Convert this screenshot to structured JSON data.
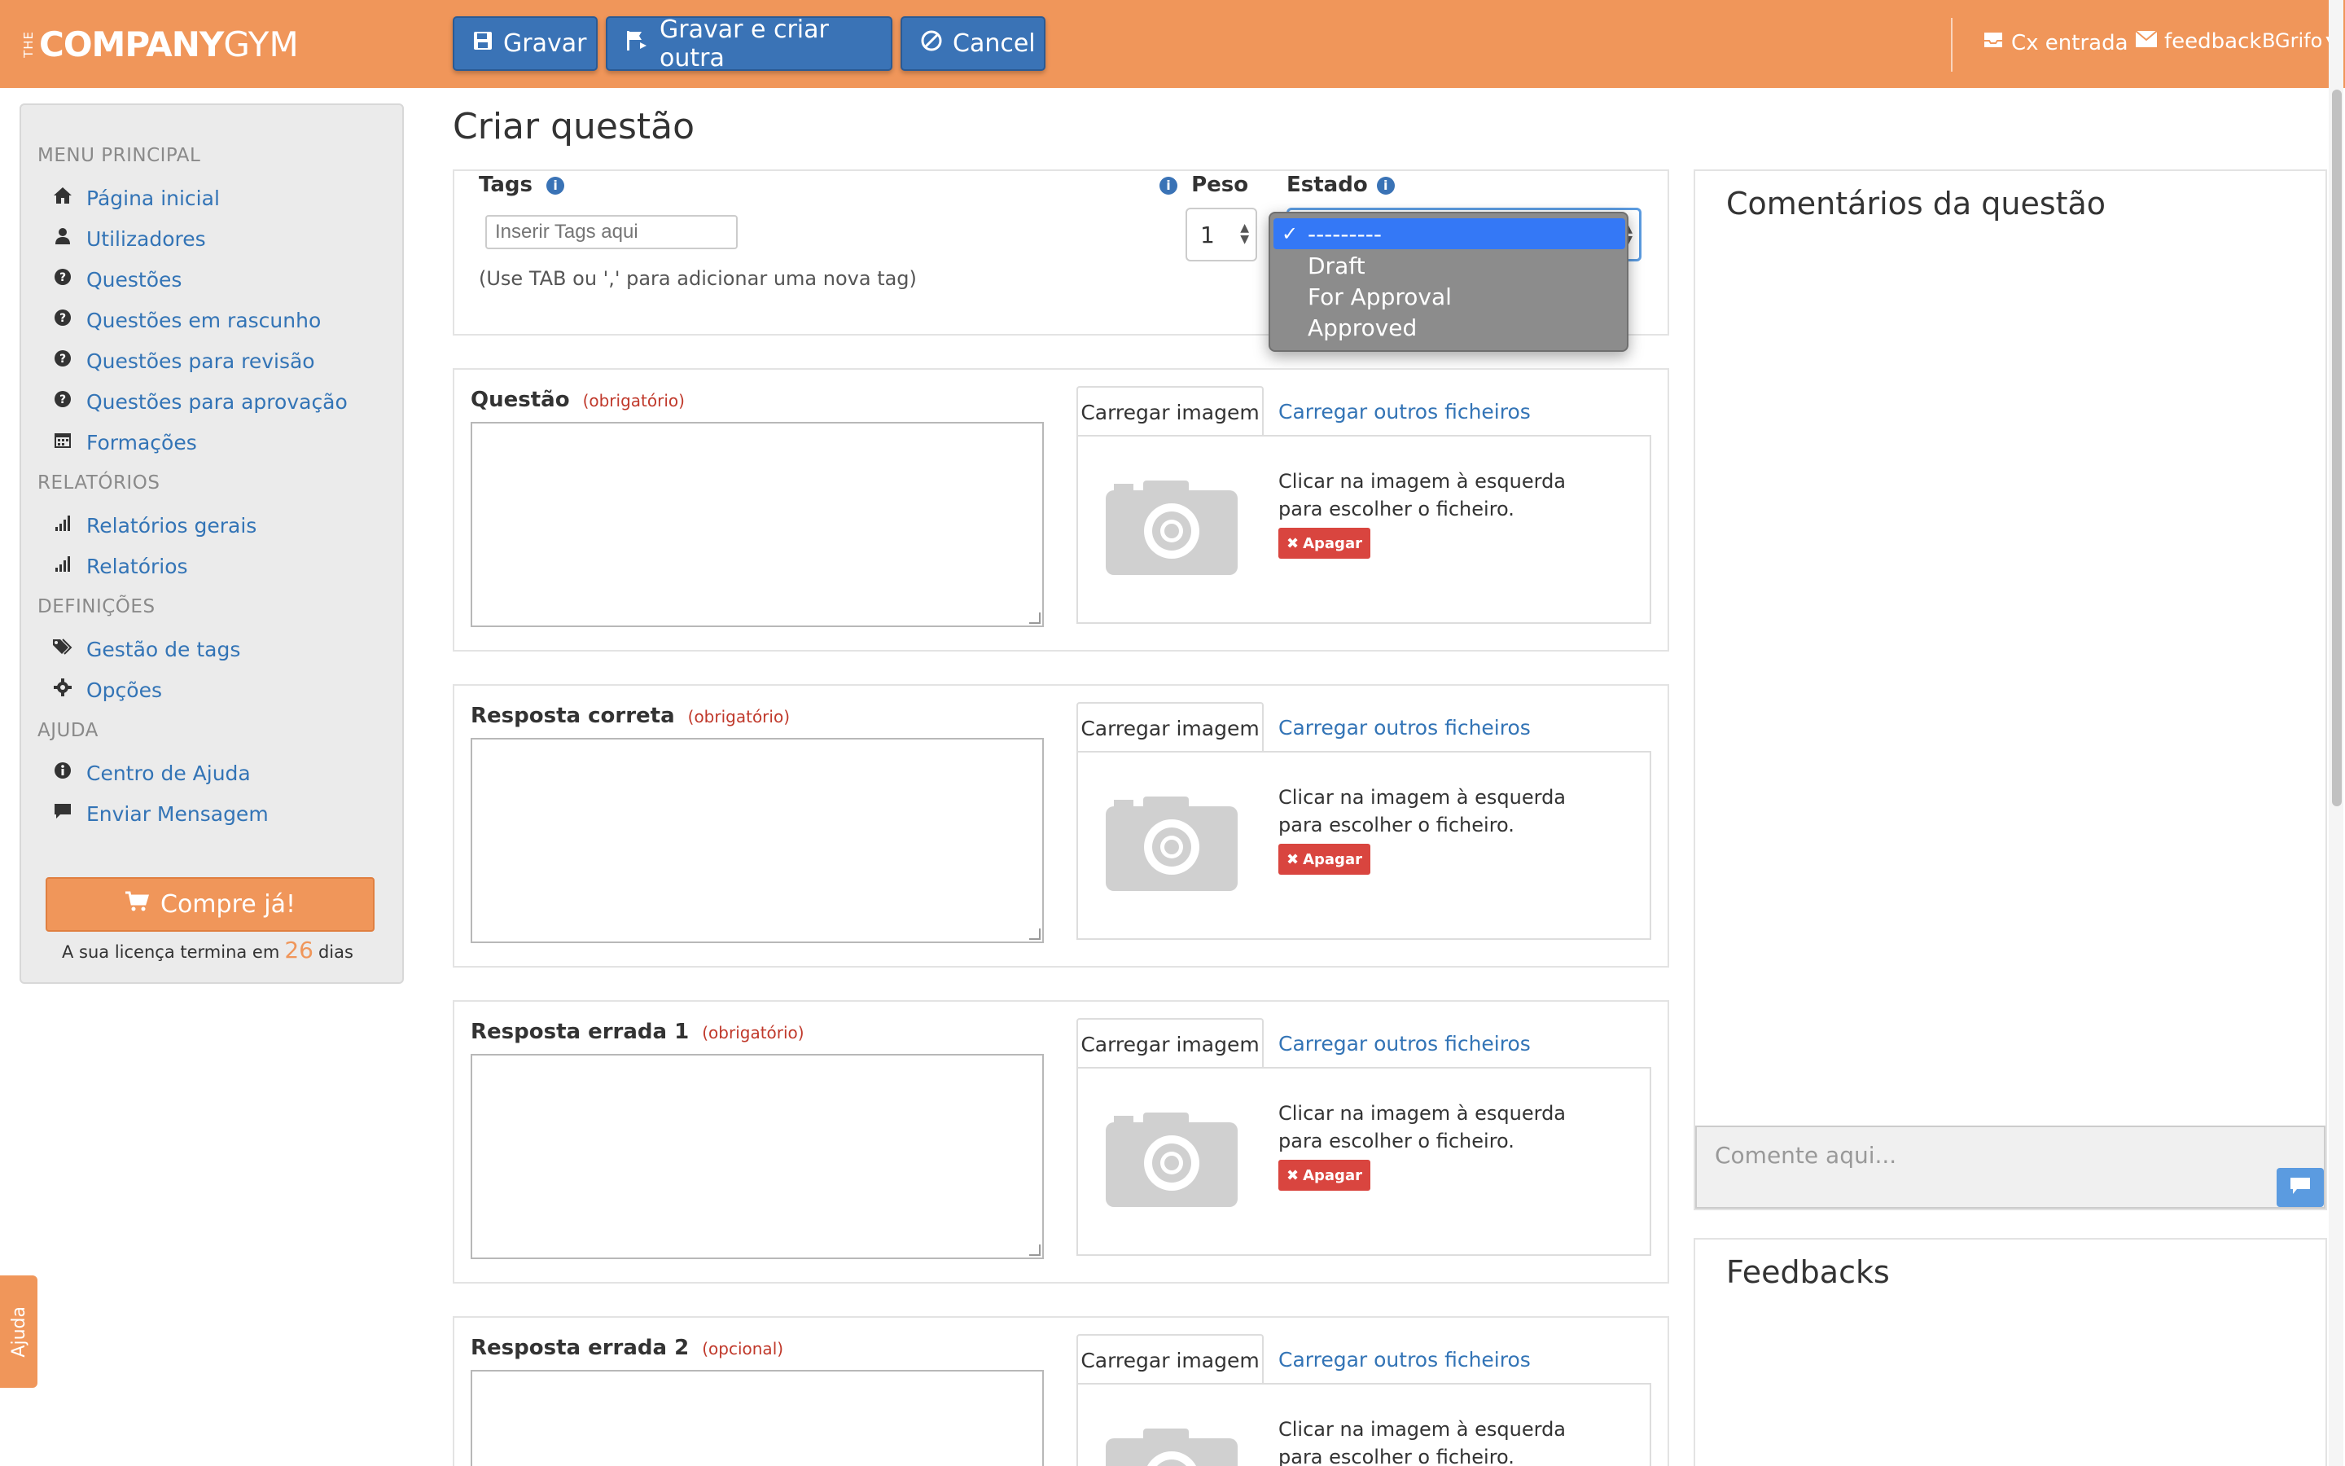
{
  "brand": {
    "the": "THE",
    "company": "COMPANY",
    "gym": "GYM"
  },
  "toolbar": {
    "save": "Gravar",
    "save_new": "Gravar e criar outra",
    "cancel": "Cancel"
  },
  "topright": {
    "inbox": "Cx entrada",
    "feedback": "feedback",
    "user": "BGrifo"
  },
  "sidebar": {
    "menu_principal": "MENU PRINCIPAL",
    "items_main": [
      "Página inicial",
      "Utilizadores",
      "Questões",
      "Questões em rascunho",
      "Questões para revisão",
      "Questões para aprovação",
      "Formações"
    ],
    "relatorios": "RELATÓRIOS",
    "items_rel": [
      "Relatórios gerais",
      "Relatórios"
    ],
    "definicoes": "DEFINIÇÕES",
    "items_def": [
      "Gestão de tags",
      "Opções"
    ],
    "ajuda": "AJUDA",
    "items_help": [
      "Centro de Ajuda",
      "Enviar Mensagem"
    ],
    "buy": "Compre já!",
    "license_prefix": "A sua licença termina em",
    "license_days": "26",
    "license_suffix": "dias"
  },
  "page": {
    "title": "Criar questão"
  },
  "meta": {
    "tags_label": "Tags",
    "tags_placeholder": "Inserir Tags aqui",
    "tags_hint": "(Use TAB ou ',' para adicionar uma nova tag)",
    "peso_label": "Peso",
    "peso_value": "1",
    "estado_label": "Estado",
    "estado_options": [
      "---------",
      "Draft",
      "For Approval",
      "Approved"
    ]
  },
  "upload": {
    "tab_image": "Carregar imagem",
    "tab_files": "Carregar outros ficheiros",
    "instruction_1": "Clicar na imagem à esquerda",
    "instruction_2": "para escolher o ficheiro.",
    "delete": "Apagar"
  },
  "questions": [
    {
      "label": "Questão",
      "req": "(obrigatório)"
    },
    {
      "label": "Resposta correta",
      "req": "(obrigatório)"
    },
    {
      "label": "Resposta errada 1",
      "req": "(obrigatório)"
    },
    {
      "label": "Resposta errada 2",
      "req": "(opcional)"
    }
  ],
  "right": {
    "comments_title": "Comentários da questão",
    "comment_placeholder": "Comente aqui...",
    "feedbacks_title": "Feedbacks"
  },
  "help_tab": "Ajuda",
  "colors": {
    "topbar": "#f0965a",
    "primary": "#3a73b6",
    "link": "#3374b6",
    "danger": "#d9453f"
  }
}
